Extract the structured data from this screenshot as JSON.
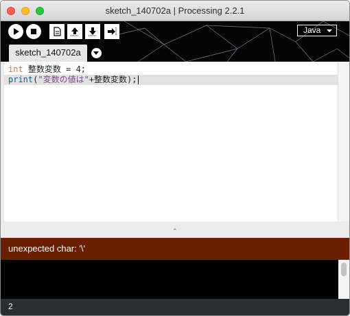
{
  "window": {
    "title": "sketch_140702a | Processing 2.2.1"
  },
  "toolbar": {
    "buttons": [
      {
        "name": "run",
        "icon": "play-icon"
      },
      {
        "name": "stop",
        "icon": "stop-icon"
      },
      {
        "name": "new",
        "icon": "new-file-icon"
      },
      {
        "name": "open",
        "icon": "open-icon"
      },
      {
        "name": "save",
        "icon": "save-icon"
      },
      {
        "name": "export",
        "icon": "export-icon"
      }
    ],
    "mode": "Java"
  },
  "tabs": [
    {
      "label": "sketch_140702a",
      "active": true
    }
  ],
  "editor": {
    "lines": [
      {
        "keyword": "int",
        "rest": " 整数変数 = 4;"
      },
      {
        "fn": "print",
        "open": "(",
        "string": "\"変数の値は\"",
        "rest": "+整数変数);"
      }
    ],
    "current_line": 2
  },
  "status": {
    "message": "unexpected char: '\\'",
    "color": "#6b1e02"
  },
  "footer": {
    "line_number": "2"
  },
  "colors": {
    "toolbar_bg": "#050505",
    "keyword": "#cf7a33",
    "function": "#006699",
    "string": "#7d4793",
    "error_bg": "#6b1e02"
  }
}
